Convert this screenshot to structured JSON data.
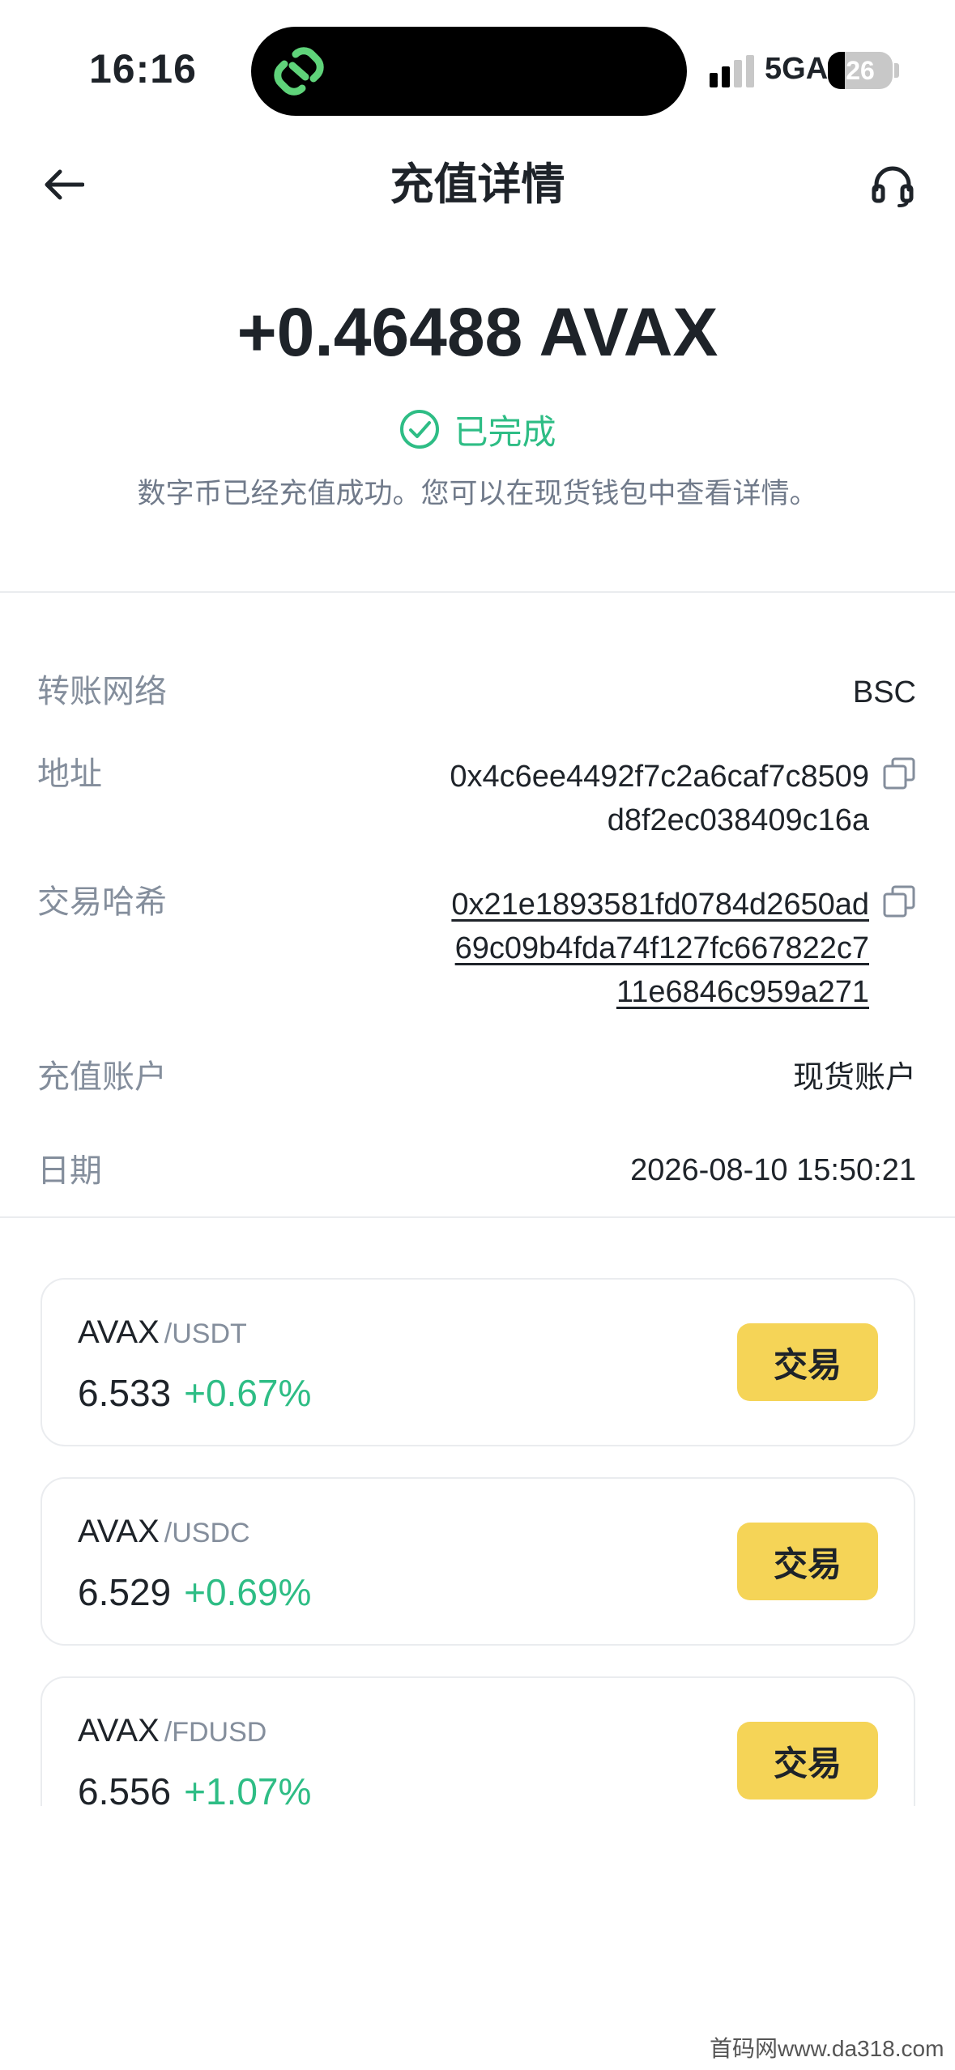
{
  "status_bar": {
    "time": "16:16",
    "network": "5GA",
    "battery": "26",
    "battery_level": 0.26
  },
  "header": {
    "title": "充值详情",
    "back_icon": "arrow-left-icon",
    "support_icon": "headset-icon"
  },
  "summary": {
    "amount": "+0.46488 AVAX",
    "status": "已完成",
    "status_color": "#2ebd85",
    "description": "数字币已经充值成功。您可以在现货钱包中查看详情。"
  },
  "details": {
    "network_label": "转账网络",
    "network_value": "BSC",
    "address_label": "地址",
    "address_lines": [
      "0x4c6ee4492f7c2a6caf7c8509",
      "d8f2ec038409c16a"
    ],
    "hash_label": "交易哈希",
    "hash_lines": [
      "0x21e1893581fd0784d2650ad",
      "69c09b4fda74f127fc667822c7",
      "11e6846c959a271"
    ],
    "account_label": "充值账户",
    "account_value": "现货账户",
    "date_label": "日期",
    "date_value": "2026-08-10 15:50:21"
  },
  "pairs": [
    {
      "base": "AVAX",
      "quote": "/USDT",
      "price": "6.533",
      "change": "+0.67%",
      "action": "交易"
    },
    {
      "base": "AVAX",
      "quote": "/USDC",
      "price": "6.529",
      "change": "+0.69%",
      "action": "交易"
    },
    {
      "base": "AVAX",
      "quote": "/FDUSD",
      "price": "6.556",
      "change": "+1.07%",
      "action": "交易"
    }
  ],
  "colors": {
    "accent_yellow": "#f5d457",
    "positive_green": "#2ebd85",
    "secondary_text": "#848e9c"
  },
  "watermark": "首码网www.da318.com"
}
